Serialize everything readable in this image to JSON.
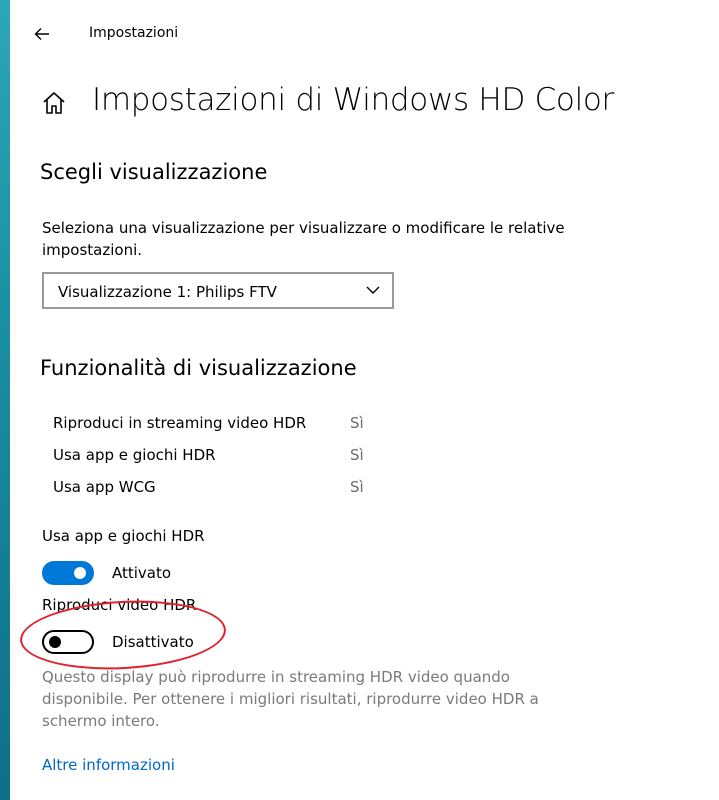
{
  "window": {
    "app_title": "Impostazioni",
    "back_icon": "arrow-left-icon",
    "home_icon": "home-icon"
  },
  "page": {
    "title": "Impostazioni di Windows HD Color"
  },
  "choose_display": {
    "heading": "Scegli visualizzazione",
    "description": "Seleziona una visualizzazione per visualizzare o modificare le relative impostazioni.",
    "dropdown_value": "Visualizzazione 1: Philips FTV"
  },
  "capabilities": {
    "heading": "Funzionalità di visualizzazione",
    "rows": [
      {
        "label": "Riproduci in streaming video HDR",
        "value": "Sì"
      },
      {
        "label": "Usa app e giochi HDR",
        "value": "Sì"
      },
      {
        "label": "Usa app WCG",
        "value": "Sì"
      }
    ]
  },
  "hdr_games": {
    "label": "Usa app e giochi HDR",
    "state": "Attivato",
    "on": true
  },
  "hdr_video": {
    "label": "Riproduci video HDR",
    "state": "Disattivato",
    "on": false
  },
  "info": {
    "text": "Questo display può riprodurre in streaming HDR video quando disponibile. Per ottenere i migliori risultati, riprodurre video HDR a schermo intero.",
    "link": "Altre informazioni"
  },
  "colors": {
    "accent": "#0078d7",
    "annotation": "#e0202a",
    "link": "#0066cc"
  }
}
